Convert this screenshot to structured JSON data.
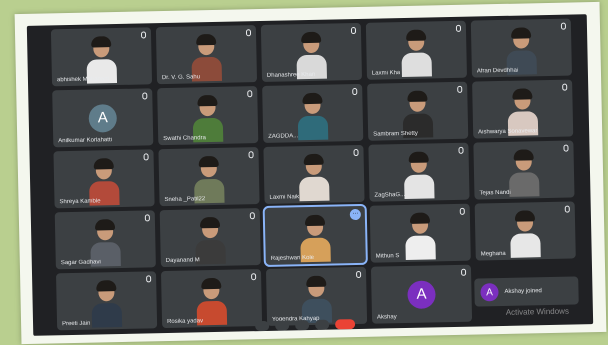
{
  "participants": [
    {
      "name": "abhishek Mohanani",
      "type": "video",
      "body": "#e9e9e9"
    },
    {
      "name": "Dr. V. G. Sahu",
      "type": "video",
      "body": "#8c4b3a"
    },
    {
      "name": "Dhanashree Khan",
      "type": "video",
      "body": "#d9d9d9"
    },
    {
      "name": "Laxmi Kha",
      "type": "video",
      "body": "#dedede"
    },
    {
      "name": "Afran Devdhhai",
      "type": "video",
      "body": "#3f4a55"
    },
    {
      "name": "Anilkumar Korlahatti",
      "type": "avatar",
      "initial": "A",
      "color": "#5f7c8a"
    },
    {
      "name": "Swathi Chandra",
      "type": "video",
      "body": "#4e7c3a"
    },
    {
      "name": "ZAGDDA...",
      "type": "video",
      "body": "#2f6b7a"
    },
    {
      "name": "Sambram Shetty",
      "type": "video",
      "body": "#2b2b2b"
    },
    {
      "name": "Aishwarya Sonavewar",
      "type": "video",
      "body": "#d8c8c0"
    },
    {
      "name": "Shreya Kamble",
      "type": "video",
      "body": "#b34a3a"
    },
    {
      "name": "Sneha _Patil22",
      "type": "video",
      "body": "#6f7a5a"
    },
    {
      "name": "Laxmi Naik",
      "type": "video",
      "body": "#e0d8d0"
    },
    {
      "name": "ZagShaG...",
      "type": "video",
      "body": "#e4e4e4"
    },
    {
      "name": "Tejas Nandi",
      "type": "video",
      "body": "#6a6a6a"
    },
    {
      "name": "Sagar Gadhavi",
      "type": "video",
      "body": "#5a5f67"
    },
    {
      "name": "Dayanand M",
      "type": "video",
      "body": "#3b3b3b"
    },
    {
      "name": "Rajeshwari Kole",
      "type": "video",
      "body": "#d6a05a",
      "active": true
    },
    {
      "name": "Mithun S",
      "type": "video",
      "body": "#eeeeee"
    },
    {
      "name": "Meghana",
      "type": "video",
      "body": "#e7e7e7"
    },
    {
      "name": "Preeti Jain",
      "type": "video",
      "body": "#2f3b4a"
    },
    {
      "name": "Rosika yadav",
      "type": "video",
      "body": "#c74a2f"
    },
    {
      "name": "Yogendra Kahyap",
      "type": "video",
      "body": "#3e4f5d"
    },
    {
      "name": "Akshay",
      "type": "avatar",
      "initial": "A",
      "color": "#7b2fbf"
    }
  ],
  "toast": {
    "initial": "A",
    "text": "Akshay joined"
  },
  "watermark": "Activate Windows"
}
